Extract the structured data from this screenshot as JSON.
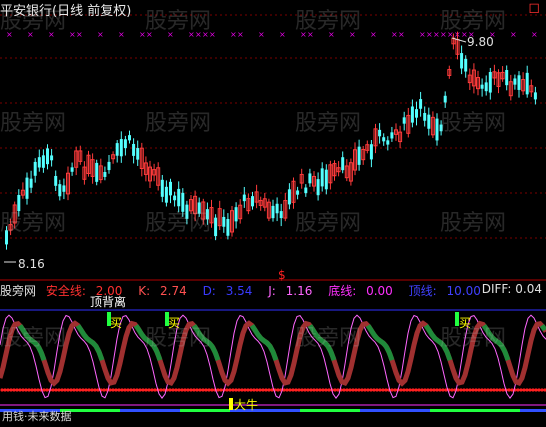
{
  "window": {
    "title": "平安银行(日线 前复权)",
    "logo": "股旁网"
  },
  "price_chart": {
    "high_label": "9.80",
    "low_label": "8.16",
    "marker": "$",
    "colors": {
      "up": "#ff3b3b",
      "down": "#54ffff",
      "grid": "#7a0000",
      "marks": "#e000e0"
    }
  },
  "indicator": {
    "name": "股旁网",
    "safe_line": {
      "label": "安全线:",
      "value": "2.00",
      "color": "#ff3030"
    },
    "k": {
      "label": "K:",
      "value": "2.74",
      "color": "#ff5050"
    },
    "d": {
      "label": "D:",
      "value": "3.54",
      "color": "#3a3aff"
    },
    "j": {
      "label": "J:",
      "value": "1.16",
      "color": "#ff66ff"
    },
    "bottom_line": {
      "label": "底线:",
      "value": "0.00",
      "color": "#ff30ff"
    },
    "top_line": {
      "label": "顶线:",
      "value": "10.00",
      "color": "#4040ff"
    },
    "diff": {
      "label": "DIFF:",
      "value": "0.04"
    },
    "signal_buy": "买",
    "signal_top": "顶背离",
    "signal_bull": "大牛",
    "bottom_text": "用钱·未来数据"
  },
  "watermark": "股旁网",
  "chart_data": {
    "type": "candlestick",
    "y_range": [
      8.16,
      9.8
    ],
    "annotations": [
      "9.80",
      "8.16"
    ]
  }
}
